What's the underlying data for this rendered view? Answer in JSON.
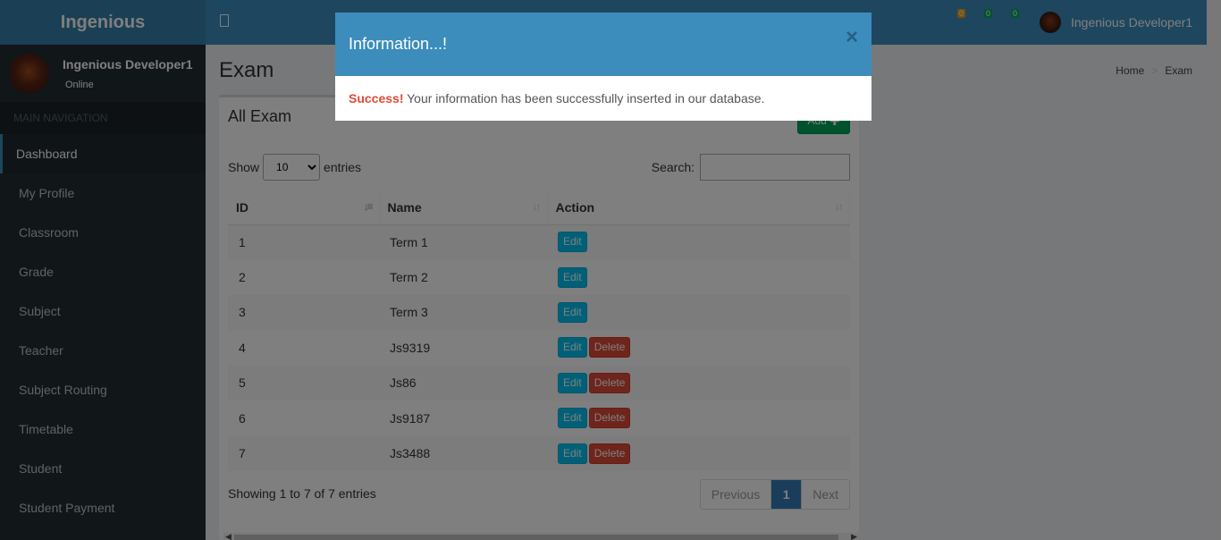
{
  "app": {
    "logo": "Ingenious",
    "user_name": "Ingenious Developer1",
    "user_status": "Online",
    "badges": [
      "0",
      "0",
      "0"
    ]
  },
  "sidebar": {
    "header": "MAIN NAVIGATION",
    "items": [
      {
        "label": "Dashboard",
        "active": true
      },
      {
        "label": "My Profile"
      },
      {
        "label": "Classroom"
      },
      {
        "label": "Grade"
      },
      {
        "label": "Subject"
      },
      {
        "label": "Teacher"
      },
      {
        "label": "Subject Routing"
      },
      {
        "label": "Timetable"
      },
      {
        "label": "Student"
      },
      {
        "label": "Student Payment"
      }
    ]
  },
  "page": {
    "title": "Exam",
    "breadcrumb": [
      "Home",
      "Exam"
    ]
  },
  "box": {
    "title": "All Exam",
    "add_label": "Add",
    "show_label": "Show",
    "entries_label": "entries",
    "length_value": "10",
    "search_label": "Search:",
    "search_value": ""
  },
  "table": {
    "columns": [
      "ID",
      "Name",
      "Action"
    ],
    "rows": [
      {
        "id": "1",
        "name": "Term 1",
        "actions": [
          "Edit"
        ]
      },
      {
        "id": "2",
        "name": "Term 2",
        "actions": [
          "Edit"
        ]
      },
      {
        "id": "3",
        "name": "Term 3",
        "actions": [
          "Edit"
        ]
      },
      {
        "id": "4",
        "name": "Js9319",
        "actions": [
          "Edit",
          "Delete"
        ]
      },
      {
        "id": "5",
        "name": "Js86",
        "actions": [
          "Edit",
          "Delete"
        ]
      },
      {
        "id": "6",
        "name": "Js9187",
        "actions": [
          "Edit",
          "Delete"
        ]
      },
      {
        "id": "7",
        "name": "Js3488",
        "actions": [
          "Edit",
          "Delete"
        ]
      }
    ]
  },
  "footer": {
    "info": "Showing 1 to 7 of 7 entries",
    "previous": "Previous",
    "current_page": "1",
    "next": "Next"
  },
  "modal": {
    "title": "Information...!",
    "close": "×",
    "success_label": "Success!",
    "message": " Your information has been successfully inserted in our database."
  },
  "colors": {
    "header": "#3c8dbc",
    "sidebar": "#222d32",
    "success": "#00a65a",
    "info": "#00c0ef",
    "danger": "#dd4b39",
    "primary": "#337ab7"
  }
}
